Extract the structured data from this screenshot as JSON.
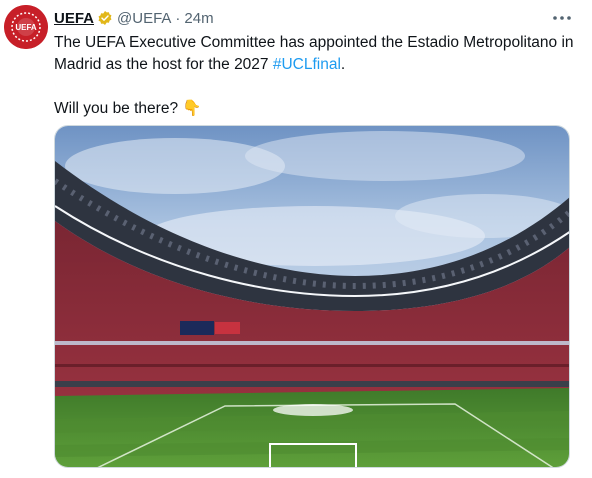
{
  "tweet": {
    "author_name": "UEFA",
    "author_handle": "@UEFA",
    "separator": "·",
    "timestamp": "24m",
    "verified": true,
    "verified_color": "#e2b719",
    "text_line1": "The UEFA Executive Committee has appointed the Estadio Metropolitano in",
    "text_line2_prefix": "Madrid as the host for the 2027 ",
    "hashtag": "#UCLfinal",
    "text_line2_suffix": ".",
    "text_line3": "Will you be there? ",
    "emoji": "👇",
    "hashtag_color": "#1d9bf0",
    "media_alt": "Estadio Metropolitano stadium interior at dusk"
  },
  "avatar": {
    "logo_text": "UEFA",
    "bg_color": "#c71f28"
  },
  "icons": {
    "more": "more-icon",
    "verified": "verified-badge-icon"
  }
}
